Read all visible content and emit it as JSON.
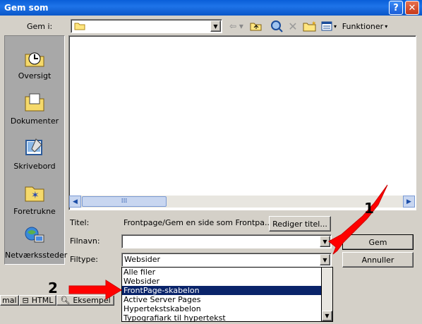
{
  "window": {
    "title": "Gem som"
  },
  "toolbar": {
    "save_in_label": "Gem i:",
    "save_in_value": "",
    "tools_label": "Funktioner"
  },
  "places": [
    {
      "label": "Oversigt",
      "icon": "history-icon"
    },
    {
      "label": "Dokumenter",
      "icon": "documents-icon"
    },
    {
      "label": "Skrivebord",
      "icon": "desktop-icon"
    },
    {
      "label": "Foretrukne",
      "icon": "favorites-icon"
    },
    {
      "label": "Netværkssteder",
      "icon": "network-icon"
    }
  ],
  "form": {
    "title_label": "Titel:",
    "title_value": "Frontpage/Gem en side som Frontpa...",
    "edit_title_button": "Rediger titel...",
    "filename_label": "Filnavn:",
    "filename_value": "",
    "filetype_label": "Filtype:",
    "filetype_value": "Websider",
    "save_button": "Gem",
    "cancel_button": "Annuller"
  },
  "filetype_options": [
    {
      "label": "Alle filer",
      "selected": false
    },
    {
      "label": "Websider",
      "selected": false
    },
    {
      "label": "FrontPage-skabelon",
      "selected": true
    },
    {
      "label": "Active Server Pages",
      "selected": false
    },
    {
      "label": "Hypertekstskabelon",
      "selected": false
    },
    {
      "label": "Typografiark til hypertekst",
      "selected": false
    }
  ],
  "background_tabs": {
    "normal": "mal",
    "html": "HTML",
    "preview": "Eksempel"
  },
  "annotations": [
    {
      "number": "1"
    },
    {
      "number": "2"
    }
  ],
  "colors": {
    "titlebar": "#0a5fd8",
    "selection": "#0a246a",
    "arrow": "#ff0000"
  }
}
